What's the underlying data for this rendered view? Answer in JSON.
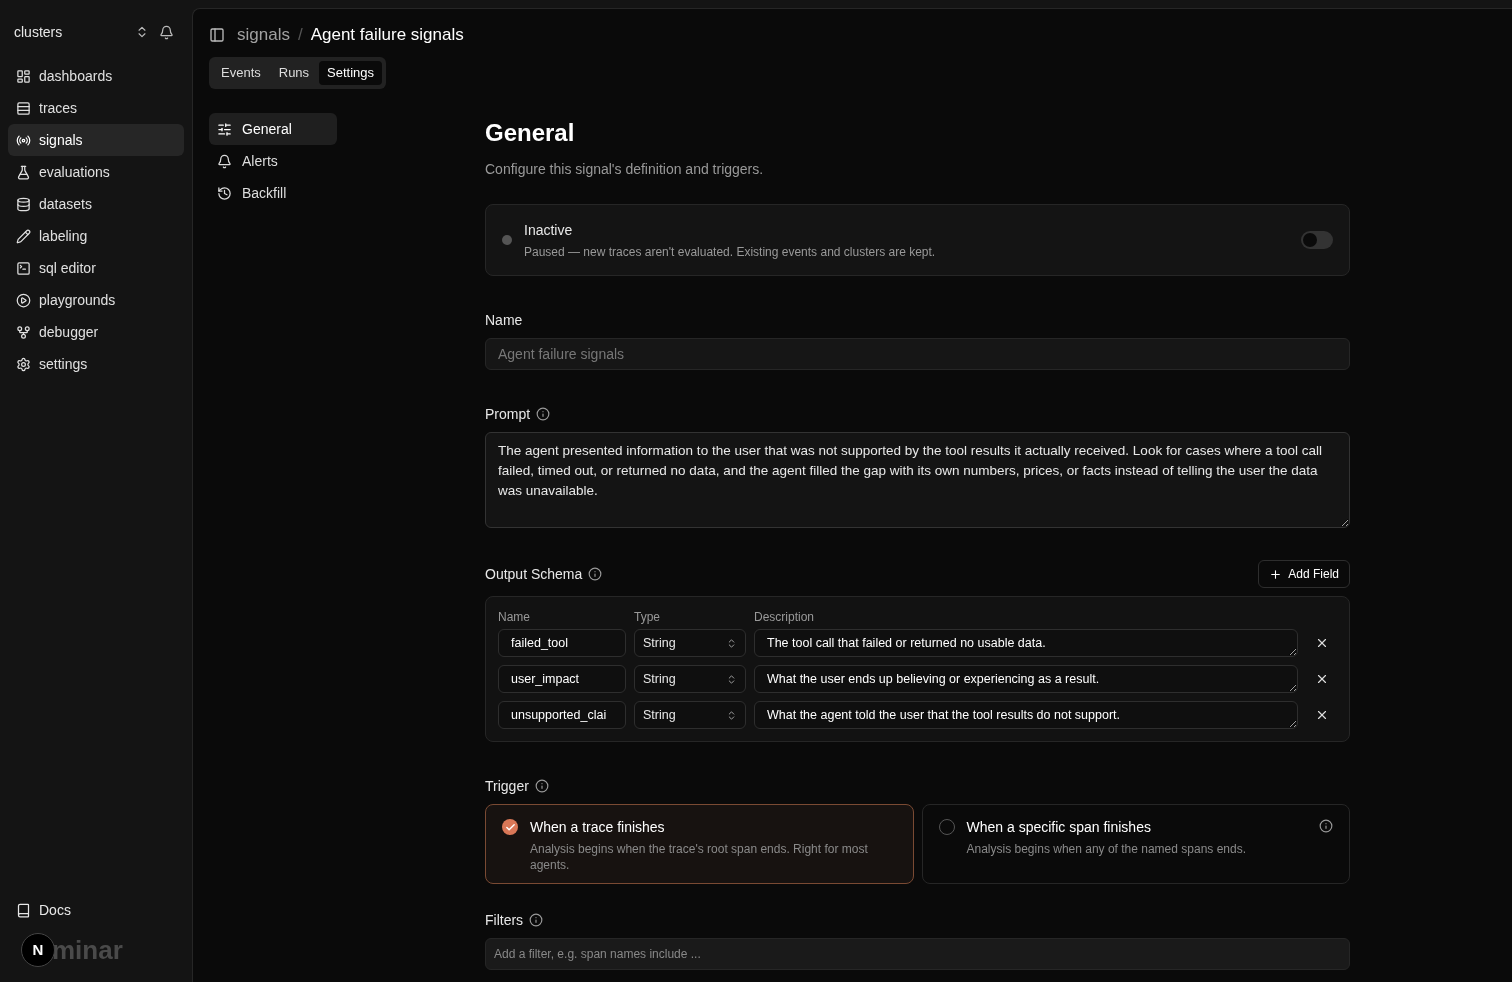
{
  "sidebar": {
    "workspace": "clusters",
    "items": [
      {
        "label": "dashboards",
        "selected": false
      },
      {
        "label": "traces",
        "selected": false
      },
      {
        "label": "signals",
        "selected": true
      },
      {
        "label": "evaluations",
        "selected": false
      },
      {
        "label": "datasets",
        "selected": false
      },
      {
        "label": "labeling",
        "selected": false
      },
      {
        "label": "sql editor",
        "selected": false
      },
      {
        "label": "playgrounds",
        "selected": false
      },
      {
        "label": "debugger",
        "selected": false
      },
      {
        "label": "settings",
        "selected": false
      }
    ],
    "footer_link": "Docs",
    "logo": "minar",
    "dev_badge": "N"
  },
  "breadcrumb": [
    "signals",
    "Agent failure signals"
  ],
  "breadcrumb_separator": "/",
  "tabs": [
    {
      "label": "Events",
      "selected": false
    },
    {
      "label": "Runs",
      "selected": false
    },
    {
      "label": "Settings",
      "selected": true
    }
  ],
  "settings_nav": [
    {
      "label": "General",
      "selected": true
    },
    {
      "label": "Alerts",
      "selected": false
    },
    {
      "label": "Backfill",
      "selected": false
    }
  ],
  "general": {
    "title": "General",
    "subtitle": "Configure this signal's definition and triggers.",
    "status": {
      "title": "Inactive",
      "description": "Paused — new traces aren't evaluated. Existing events and clusters are kept.",
      "on": false
    },
    "name": {
      "label": "Name",
      "value": "Agent failure signals",
      "disabled": true
    },
    "prompt": {
      "label": "Prompt",
      "value": "The agent presented information to the user that was not supported by the tool results it actually received. Look for cases where a tool call failed, timed out, or returned no data, and the agent filled the gap with its own numbers, prices, or facts instead of telling the user the data was unavailable."
    },
    "output_schema": {
      "label": "Output Schema",
      "add_button": "Add Field",
      "columns": [
        "Name",
        "Type",
        "Description"
      ],
      "rows": [
        {
          "name": "failed_tool",
          "type": "String",
          "description": "The tool call that failed or returned no usable data."
        },
        {
          "name": "user_impact",
          "type": "String",
          "description": "What the user ends up believing or experiencing as a result."
        },
        {
          "name": "unsupported_clai",
          "type": "String",
          "description": "What the agent told the user that the tool results do not support."
        }
      ]
    },
    "trigger": {
      "label": "Trigger",
      "options": [
        {
          "title": "When a trace finishes",
          "description": "Analysis begins when the trace's root span ends. Right for most agents.",
          "selected": true,
          "info": false
        },
        {
          "title": "When a specific span finishes",
          "description": "Analysis begins when any of the named spans ends.",
          "selected": false,
          "info": true
        }
      ]
    },
    "filters": {
      "label": "Filters",
      "placeholder": "Add a filter, e.g. span names include ..."
    }
  }
}
